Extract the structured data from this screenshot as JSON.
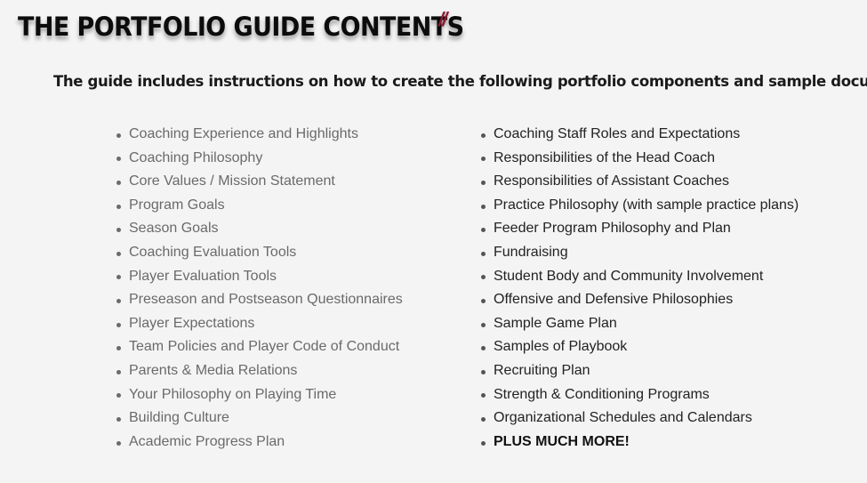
{
  "header": {
    "title": "THE PORTFOLIO GUIDE CONTENTS",
    "accent_mark": "//",
    "accent_color": "#8c1c32"
  },
  "intro": {
    "text": "The guide includes instructions on how to create the following portfolio components and sample documents:"
  },
  "lists": {
    "left": [
      "Coaching Experience and Highlights",
      "Coaching Philosophy",
      "Core Values / Mission Statement",
      "Program Goals",
      "Season Goals",
      "Coaching Evaluation Tools",
      "Player Evaluation Tools",
      "Preseason and Postseason Questionnaires",
      "Player Expectations",
      "Team Policies and Player Code of Conduct",
      "Parents & Media Relations",
      "Your Philosophy on Playing Time",
      "Building Culture",
      "Academic Progress Plan"
    ],
    "right": [
      "Coaching Staff Roles and Expectations",
      "Responsibilities of the Head Coach",
      "Responsibilities of Assistant Coaches",
      "Practice Philosophy (with sample practice plans)",
      "Feeder Program Philosophy and Plan",
      "Fundraising",
      "Student Body and Community Involvement",
      "Offensive and Defensive Philosophies",
      "Sample Game Plan",
      "Samples of Playbook",
      "Recruiting Plan",
      "Strength & Conditioning Programs",
      "Organizational Schedules and Calendars",
      "PLUS MUCH MORE!"
    ]
  },
  "colors": {
    "background": "#f4f4f4",
    "left_text": "#6a6a6a",
    "right_text": "#222222"
  }
}
